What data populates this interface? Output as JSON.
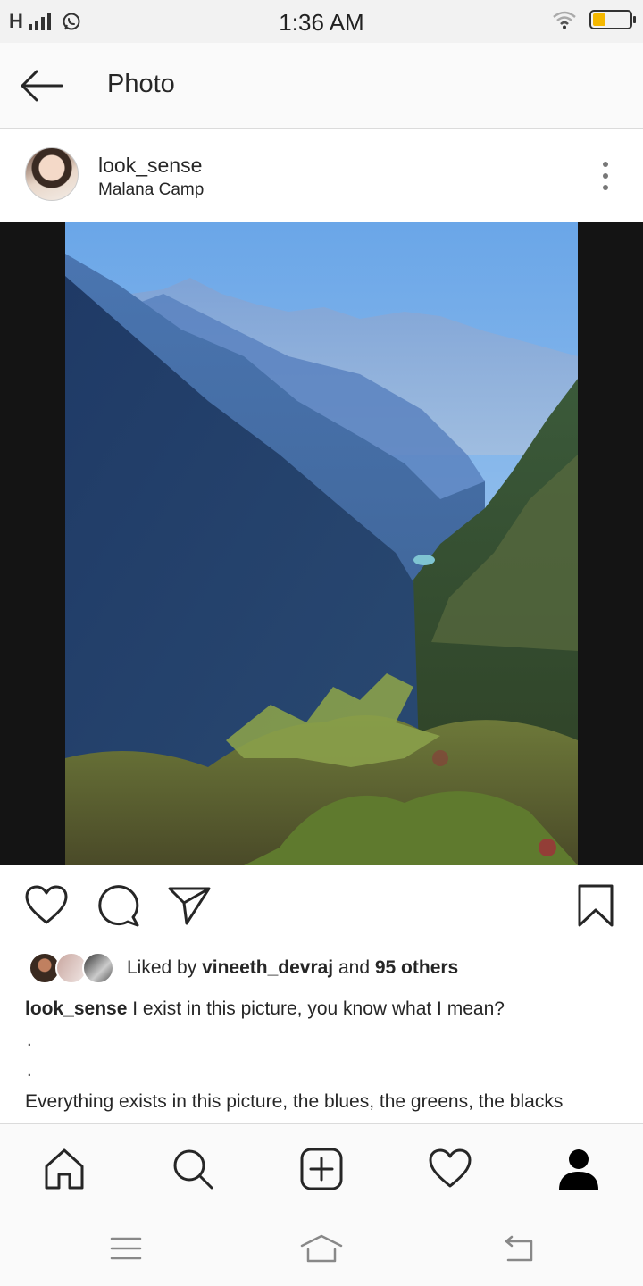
{
  "status_bar": {
    "network": "H",
    "time": "1:36 AM",
    "battery_color": "#f5b800",
    "icons": [
      "signal-icon",
      "whatsapp-icon",
      "wifi-icon",
      "battery-icon"
    ]
  },
  "header": {
    "title": "Photo",
    "back_icon": "arrow-left-icon"
  },
  "post": {
    "username": "look_sense",
    "location": "Malana Camp",
    "more_icon": "more-vertical-icon",
    "photo_alt": "Mountain valley landscape"
  },
  "actions": {
    "icons": [
      "heart-icon",
      "comment-icon",
      "share-icon",
      "bookmark-icon"
    ]
  },
  "likes": {
    "prefix": "Liked by ",
    "user": "vineeth_devraj",
    "conjunction": " and ",
    "others": "95 others"
  },
  "caption": {
    "username": "look_sense",
    "text": " I exist in this picture, you know what I mean?",
    "dot1": ".",
    "dot2": ".",
    "line2": "Everything exists in this picture, the blues, the greens, the blacks"
  },
  "bottom_nav": {
    "items": [
      "home-icon",
      "search-icon",
      "add-post-icon",
      "activity-heart-icon",
      "profile-icon"
    ]
  },
  "system_nav": {
    "items": [
      "menu-icon",
      "home-outline-icon",
      "back-icon"
    ]
  }
}
